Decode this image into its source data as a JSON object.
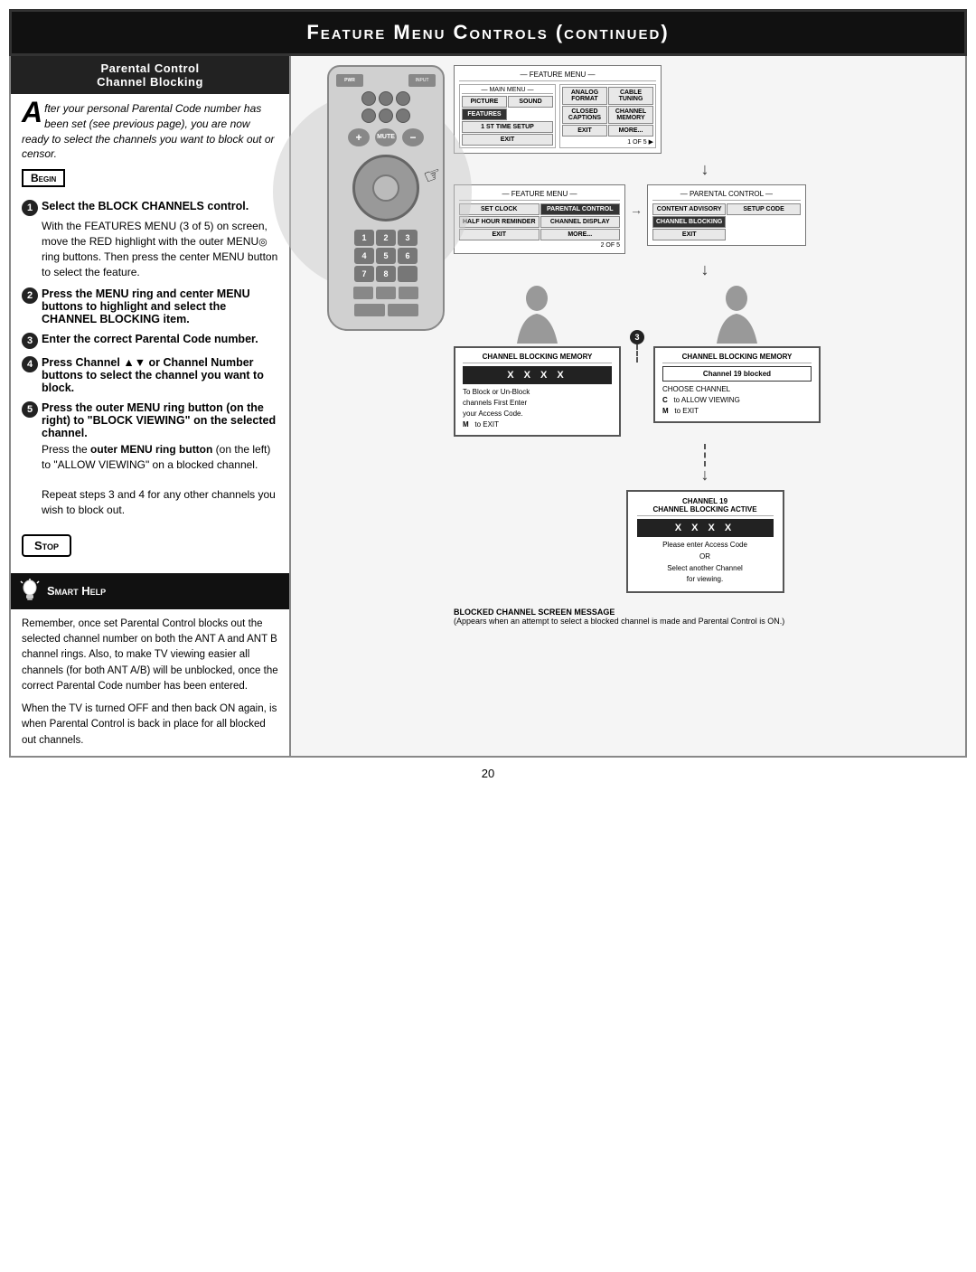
{
  "header": {
    "title": "Feature Menu Controls (continued)"
  },
  "left_panel": {
    "section_title_line1": "Parental Control",
    "section_title_line2": "Channel Blocking",
    "intro": {
      "drop_cap": "A",
      "text": "fter your personal Parental Code number has been set (see previous page), you are now ready to select the channels you want to block out or censor."
    },
    "begin_label": "Begin",
    "steps": [
      {
        "num": "1",
        "title": "Select the BLOCK CHANNELS control.",
        "body": "With the FEATURES MENU (3 of 5) on screen, move the RED highlight with the outer MENU ring buttons. Then press the center MENU button to select the feature."
      },
      {
        "num": "2",
        "title": "Press the MENU ring and center MENU buttons to highlight and select the CHANNEL BLOCKING item."
      },
      {
        "num": "3",
        "title": "Enter the correct Parental Code number."
      },
      {
        "num": "4",
        "title": "Press Channel ▲▼ or Channel Number buttons to select the channel you want to block."
      },
      {
        "num": "5",
        "title": "Press the outer MENU ring button (on the right) to \"BLOCK VIEWING\" on the selected channel.",
        "body2": "Press the outer MENU ring button (on the left) to \"ALLOW VIEWING\" on a blocked channel.",
        "body3": "Repeat steps 3 and 4 for any other channels you wish to block out."
      }
    ],
    "stop_label": "Stop",
    "smart_help": {
      "title": "Smart Help",
      "body": "Remember, once set Parental Control blocks out the selected channel number on both the ANT A and ANT B channel rings. Also, to make TV viewing easier all channels (for both ANT A/B) will be unblocked, once the correct Parental Code number has been entered.\nWhen the TV is turned OFF and then back ON again, is when Parental Control is back in place for all blocked out channels."
    }
  },
  "right_panel": {
    "menu1": {
      "title": "— FEATURE MENU —",
      "main_menu_title": "— MAIN MENU —",
      "items": [
        "PICTURE",
        "SOUND",
        "FEATURES",
        "1 ST TIME SETUP",
        "EXIT"
      ],
      "items2": [
        "ANALOG FORMAT",
        "CABLE TUNING",
        "CLOSED CAPTIONS",
        "CHANNEL MEMORY",
        "EXIT",
        "MORE..."
      ],
      "page_label": "1 OF 5"
    },
    "menu2": {
      "title": "— FEATURE MENU —",
      "items": [
        "SET CLOCK",
        "PARENTAL CONTROL",
        "HALF HOUR REMINDER",
        "CHANNEL DISPLAY",
        "EXIT",
        "MORE..."
      ],
      "page_label": "2 OF 5",
      "parental_menu_title": "— PARENTAL CONTROL —",
      "parental_items": [
        "CONTENT ADVISORY",
        "SETUP CODE",
        "CHANNEL BLOCKING",
        "EXIT"
      ]
    },
    "blocking_screen1": {
      "title": "CHANNEL BLOCKING MEMORY",
      "xs": "X  X  X  X",
      "text1": "To Block or Un-Block",
      "text2": "channels First Enter",
      "text3": "your Access Code.",
      "m_label": "M",
      "m_text": "to EXIT"
    },
    "blocking_screen2": {
      "title": "CHANNEL BLOCKING MEMORY",
      "channel_blocked": "Channel 19 blocked",
      "choose_text": "CHOOSE CHANNEL",
      "c_label": "C",
      "c_text": "to ALLOW VIEWING",
      "m_label": "M",
      "m_text": "to EXIT"
    },
    "bottom_screen": {
      "title1": "CHANNEL 19",
      "title2": "CHANNEL BLOCKING ACTIVE",
      "xs": "X  X  X  X",
      "text1": "Please enter Access Code",
      "text2": "OR",
      "text3": "Select another Channel",
      "text4": "for viewing."
    },
    "blocked_caption": {
      "title": "BLOCKED CHANNEL SCREEN MESSAGE",
      "text": "(Appears when an attempt to select a blocked channel is made and Parental Control is ON.)"
    }
  },
  "page_number": "20"
}
